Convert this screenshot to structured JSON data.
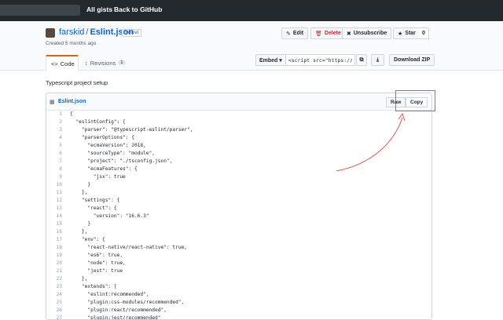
{
  "topbar": {
    "all_gists": "All gists",
    "back_to_github": "Back to GitHub"
  },
  "gist": {
    "owner": "farskid",
    "separator": "/",
    "filename": "Eslint.json",
    "secret_label": "Secret",
    "created": "Created 5 months ago"
  },
  "actions": {
    "edit": "Edit",
    "delete": "Delete",
    "unsubscribe": "Unsubscribe",
    "star": "Star",
    "star_count": "0"
  },
  "tabs": [
    {
      "label": "Code"
    },
    {
      "label": "Revisions",
      "badge": "1"
    }
  ],
  "embed": {
    "select_label": "Embed ▾",
    "input_value": "<script src=\"https://gi"
  },
  "download_zip": "Download ZIP",
  "description": "Typescript project setup",
  "file": {
    "name": "Eslint.json",
    "raw": "Raw",
    "copy": "Copy"
  },
  "code_lines": [
    {
      "n": "1",
      "t": "{"
    },
    {
      "n": "2",
      "t": "  \"eslintConfig\": {"
    },
    {
      "n": "3",
      "t": "    \"parser\": \"@typescript-eslint/parser\","
    },
    {
      "n": "4",
      "t": "    \"parserOptions\": {"
    },
    {
      "n": "5",
      "t": "      \"ecmaVersion\": 2018,"
    },
    {
      "n": "6",
      "t": "      \"sourceType\": \"module\","
    },
    {
      "n": "7",
      "t": "      \"project\": \"./tsconfig.json\","
    },
    {
      "n": "8",
      "t": "      \"ecmaFeatures\": {"
    },
    {
      "n": "9",
      "t": "        \"jsx\": true"
    },
    {
      "n": "10",
      "t": "      }"
    },
    {
      "n": "11",
      "t": "    },"
    },
    {
      "n": "12",
      "t": "    \"settings\": {"
    },
    {
      "n": "13",
      "t": "      \"react\": {"
    },
    {
      "n": "14",
      "t": "        \"version\": \"16.6.3\""
    },
    {
      "n": "15",
      "t": "      }"
    },
    {
      "n": "16",
      "t": "    },"
    },
    {
      "n": "17",
      "t": "    \"env\": {"
    },
    {
      "n": "18",
      "t": "      \"react-native/react-native\": true,"
    },
    {
      "n": "19",
      "t": "      \"es6\": true,"
    },
    {
      "n": "20",
      "t": "      \"node\": true,"
    },
    {
      "n": "21",
      "t": "      \"jest\": true"
    },
    {
      "n": "22",
      "t": "    },"
    },
    {
      "n": "23",
      "t": "    \"extends\": ["
    },
    {
      "n": "24",
      "t": "      \"eslint:recommended\","
    },
    {
      "n": "25",
      "t": "      \"plugin:css-modules/recommended\","
    },
    {
      "n": "26",
      "t": "      \"plugin:react/recommended\","
    },
    {
      "n": "27",
      "t": "      \"plugin:jest/recommended\""
    }
  ],
  "colors": {
    "topbar": "#24292e",
    "link": "#0366d6",
    "danger": "#cb2431",
    "tab_accent": "#e36209",
    "annotation": "#e5534b"
  }
}
